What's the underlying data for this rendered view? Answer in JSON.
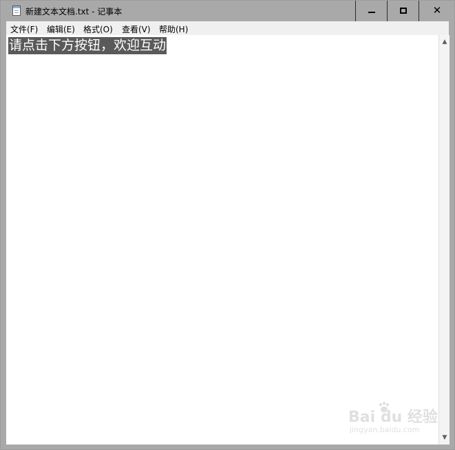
{
  "window": {
    "title": "新建文本文档.txt - 记事本",
    "close_glyph": "✕"
  },
  "menu": {
    "items": [
      {
        "label": "文件(F)"
      },
      {
        "label": "编辑(E)"
      },
      {
        "label": "格式(O)"
      },
      {
        "label": "查看(V)"
      },
      {
        "label": "帮助(H)"
      }
    ]
  },
  "editor": {
    "selected_text": "请点击下方按钮，欢迎互动"
  },
  "scrollbar": {
    "up_arrow": "▲",
    "down_arrow": "▼"
  },
  "watermark": {
    "brand": "Bai  du 经验",
    "url": "jingyan.baidu.com"
  },
  "icons": {
    "app": "notepad-icon",
    "minimize": "minimize-icon",
    "maximize": "maximize-icon",
    "close": "close-icon"
  },
  "colors": {
    "titlebar": "#a9a9a9",
    "menubar": "#f0f0f0",
    "selection": "#5a5a5a"
  }
}
